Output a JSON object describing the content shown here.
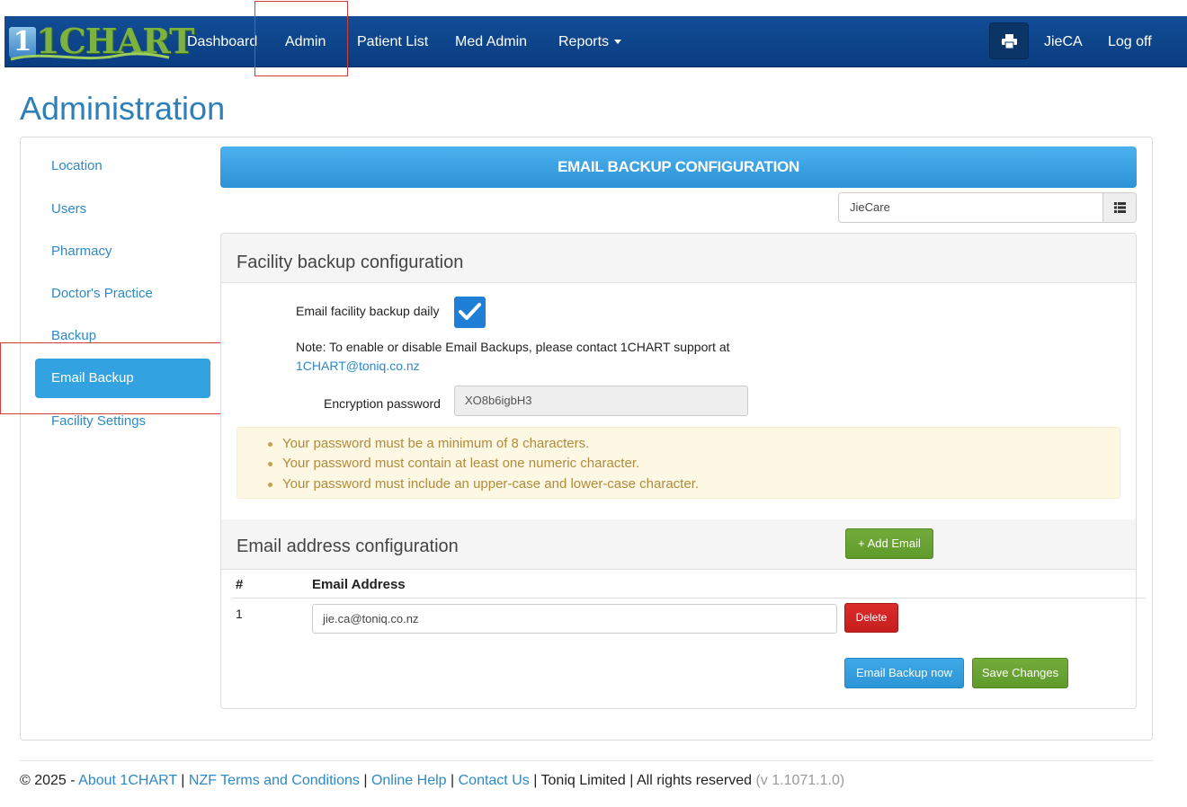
{
  "brand": {
    "logo_text": "1CHART"
  },
  "nav": {
    "items": [
      {
        "label": "Dashboard"
      },
      {
        "label": "Admin"
      },
      {
        "label": "Patient List"
      },
      {
        "label": "Med Admin"
      },
      {
        "label": "Reports"
      }
    ],
    "user": "JieCA",
    "logoff": "Log off",
    "print_icon": "printer-icon"
  },
  "page": {
    "title": "Administration"
  },
  "sidebar": {
    "items": [
      {
        "label": "Location"
      },
      {
        "label": "Users"
      },
      {
        "label": "Pharmacy"
      },
      {
        "label": "Doctor's Practice"
      },
      {
        "label": "Backup"
      },
      {
        "label": "Email Backup",
        "active": true
      },
      {
        "label": "Facility Settings"
      }
    ]
  },
  "main": {
    "banner": "EMAIL BACKUP CONFIGURATION",
    "facility_select": {
      "value": "JieCare",
      "icon": "list-icon"
    },
    "facility_backup": {
      "title": "Facility backup configuration",
      "daily_label": "Email facility backup daily",
      "daily_checked": true,
      "note": "Note: To enable or disable Email Backups, please contact 1CHART support at",
      "support_email": "1CHART@toniq.co.nz",
      "password_label": "Encryption password",
      "password_value": "XO8b6igbH3",
      "rules": [
        "Your password must be a minimum of 8 characters.",
        "Your password must contain at least one numeric character.",
        "Your password must include an upper-case and lower-case character."
      ]
    },
    "email_config": {
      "title": "Email address configuration",
      "add_button": "+ Add Email",
      "columns": [
        "#",
        "Email Address"
      ],
      "rows": [
        {
          "num": "1",
          "email": "jie.ca@toniq.co.nz",
          "delete": "Delete"
        }
      ],
      "email_backup_now": "Email Backup now",
      "save_changes": "Save Changes"
    }
  },
  "footer": {
    "copyright": "© 2025 -",
    "links": [
      "About 1CHART",
      "NZF Terms and Conditions",
      "Online Help",
      "Contact Us"
    ],
    "company": "Toniq Limited",
    "rights": "All rights reserved",
    "version": "(v 1.1071.1.0)"
  },
  "colors": {
    "nav_bg": "#124d96",
    "accent_blue": "#33a2e0",
    "link_blue": "#2d89c8",
    "success_green": "#6aa535",
    "danger_red": "#d42424",
    "warning_text": "#b28a3c",
    "highlight_red": "#d43c3c"
  }
}
